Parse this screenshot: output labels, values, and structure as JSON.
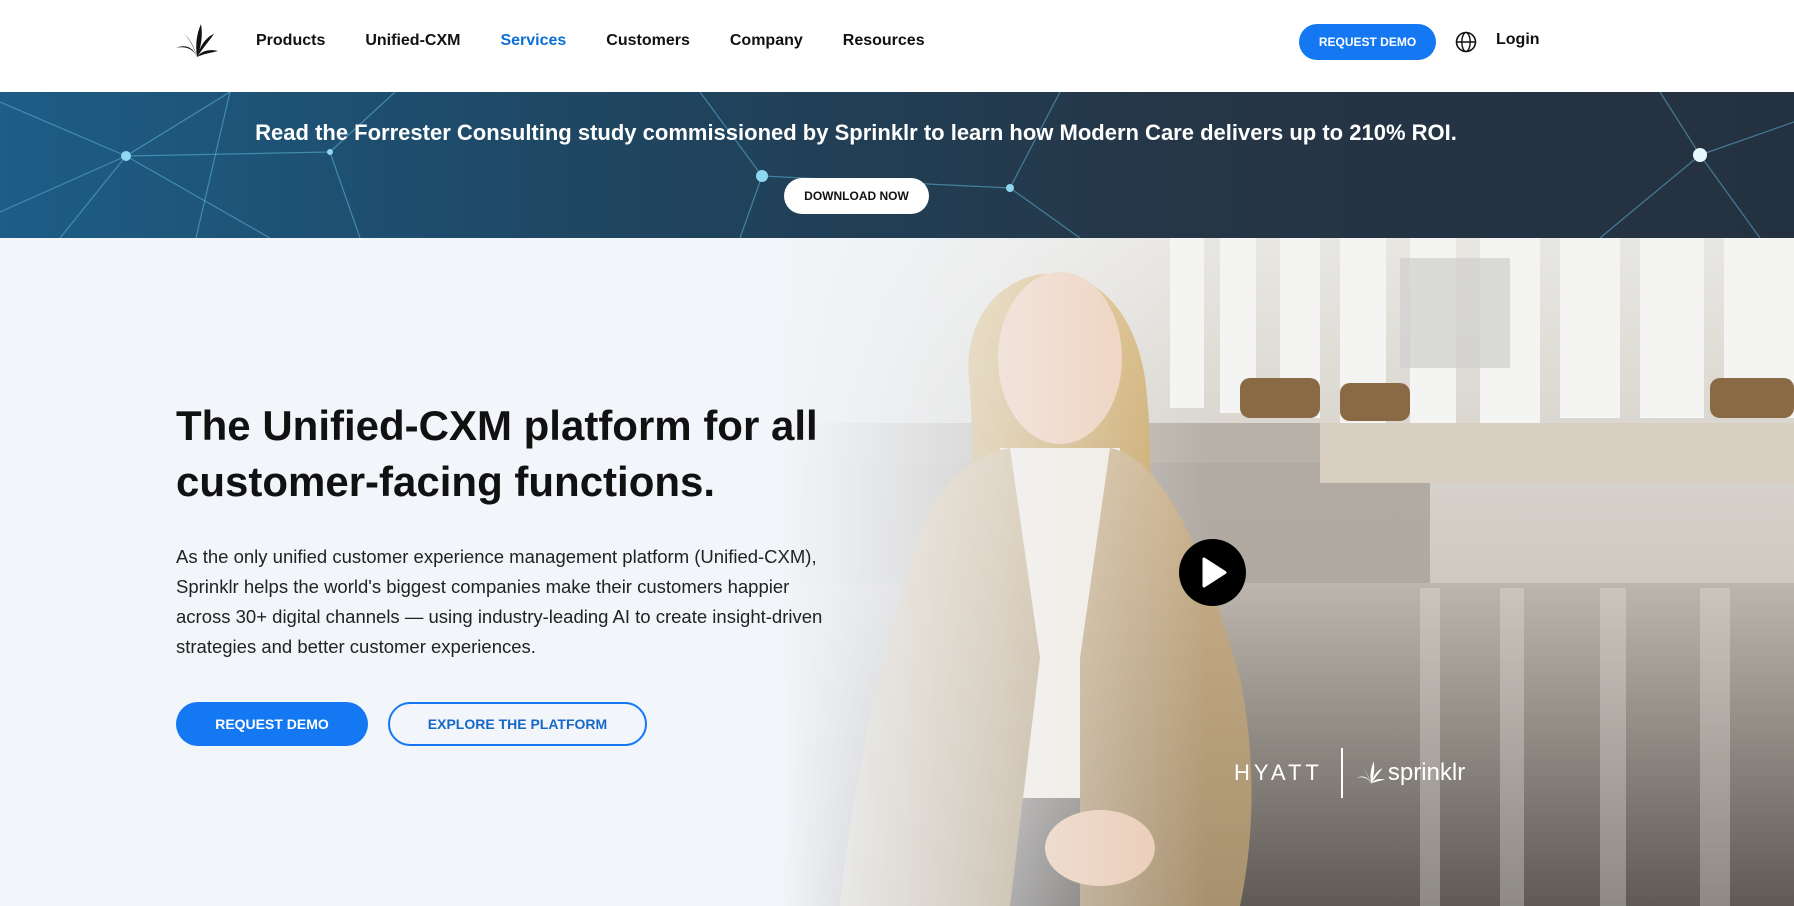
{
  "header": {
    "nav": [
      {
        "label": "Products",
        "active": false
      },
      {
        "label": "Unified-CXM",
        "active": false
      },
      {
        "label": "Services",
        "active": true
      },
      {
        "label": "Customers",
        "active": false
      },
      {
        "label": "Company",
        "active": false
      },
      {
        "label": "Resources",
        "active": false
      }
    ],
    "cta_label": "REQUEST DEMO",
    "language_icon": "globe-icon",
    "login_label": "Login"
  },
  "banner": {
    "text": "Read the Forrester Consulting study commissioned by Sprinklr to learn how Modern Care delivers up to 210% ROI.",
    "button_label": "DOWNLOAD NOW"
  },
  "hero": {
    "title": "The Unified-CXM platform for all customer-facing functions.",
    "description": "As the only unified customer experience management platform (Unified-CXM), Sprinklr helps the world's biggest companies make their customers happier across 30+ digital channels — using industry-leading AI to create insight-driven strategies and better customer experiences.",
    "primary_button": "REQUEST DEMO",
    "secondary_button": "EXPLORE THE PLATFORM",
    "video": {
      "play_icon": "play-icon",
      "partner_logo": "HYATT",
      "brand_logo": "sprinklr"
    }
  },
  "colors": {
    "accent": "#1478f3",
    "active_nav": "#0c6ed7",
    "banner_bg": "#243140",
    "hero_bg": "#f2f5f9"
  }
}
